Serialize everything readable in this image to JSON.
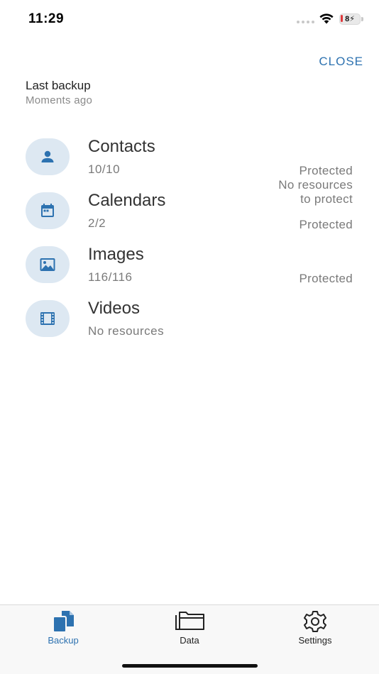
{
  "status_bar": {
    "time": "11:29",
    "battery_level": "8",
    "icons": [
      "signal-icon",
      "wifi-icon",
      "battery-charging-icon"
    ]
  },
  "header": {
    "close_label": "CLOSE"
  },
  "last_backup": {
    "title": "Last backup",
    "subtitle": "Moments ago"
  },
  "items": [
    {
      "icon": "person-icon",
      "title": "Contacts",
      "count": "10/10",
      "status": "Protected"
    },
    {
      "icon": "calendar-icon",
      "title": "Calendars",
      "count": "2/2",
      "status": "Protected"
    },
    {
      "icon": "image-icon",
      "title": "Images",
      "count": "116/116",
      "status": "Protected"
    },
    {
      "icon": "film-icon",
      "title": "Videos",
      "count": "No resources",
      "status_line1": "No resources",
      "status_line2": "to protect"
    }
  ],
  "tabs": [
    {
      "label": "Backup",
      "icon": "backup-docs-icon",
      "active": true
    },
    {
      "label": "Data",
      "icon": "folder-icon",
      "active": false
    },
    {
      "label": "Settings",
      "icon": "gear-icon",
      "active": false
    }
  ],
  "colors": {
    "accent": "#2d72b0",
    "icon_circle_bg": "#dde8f2",
    "secondary_text": "#7a7a7a"
  }
}
